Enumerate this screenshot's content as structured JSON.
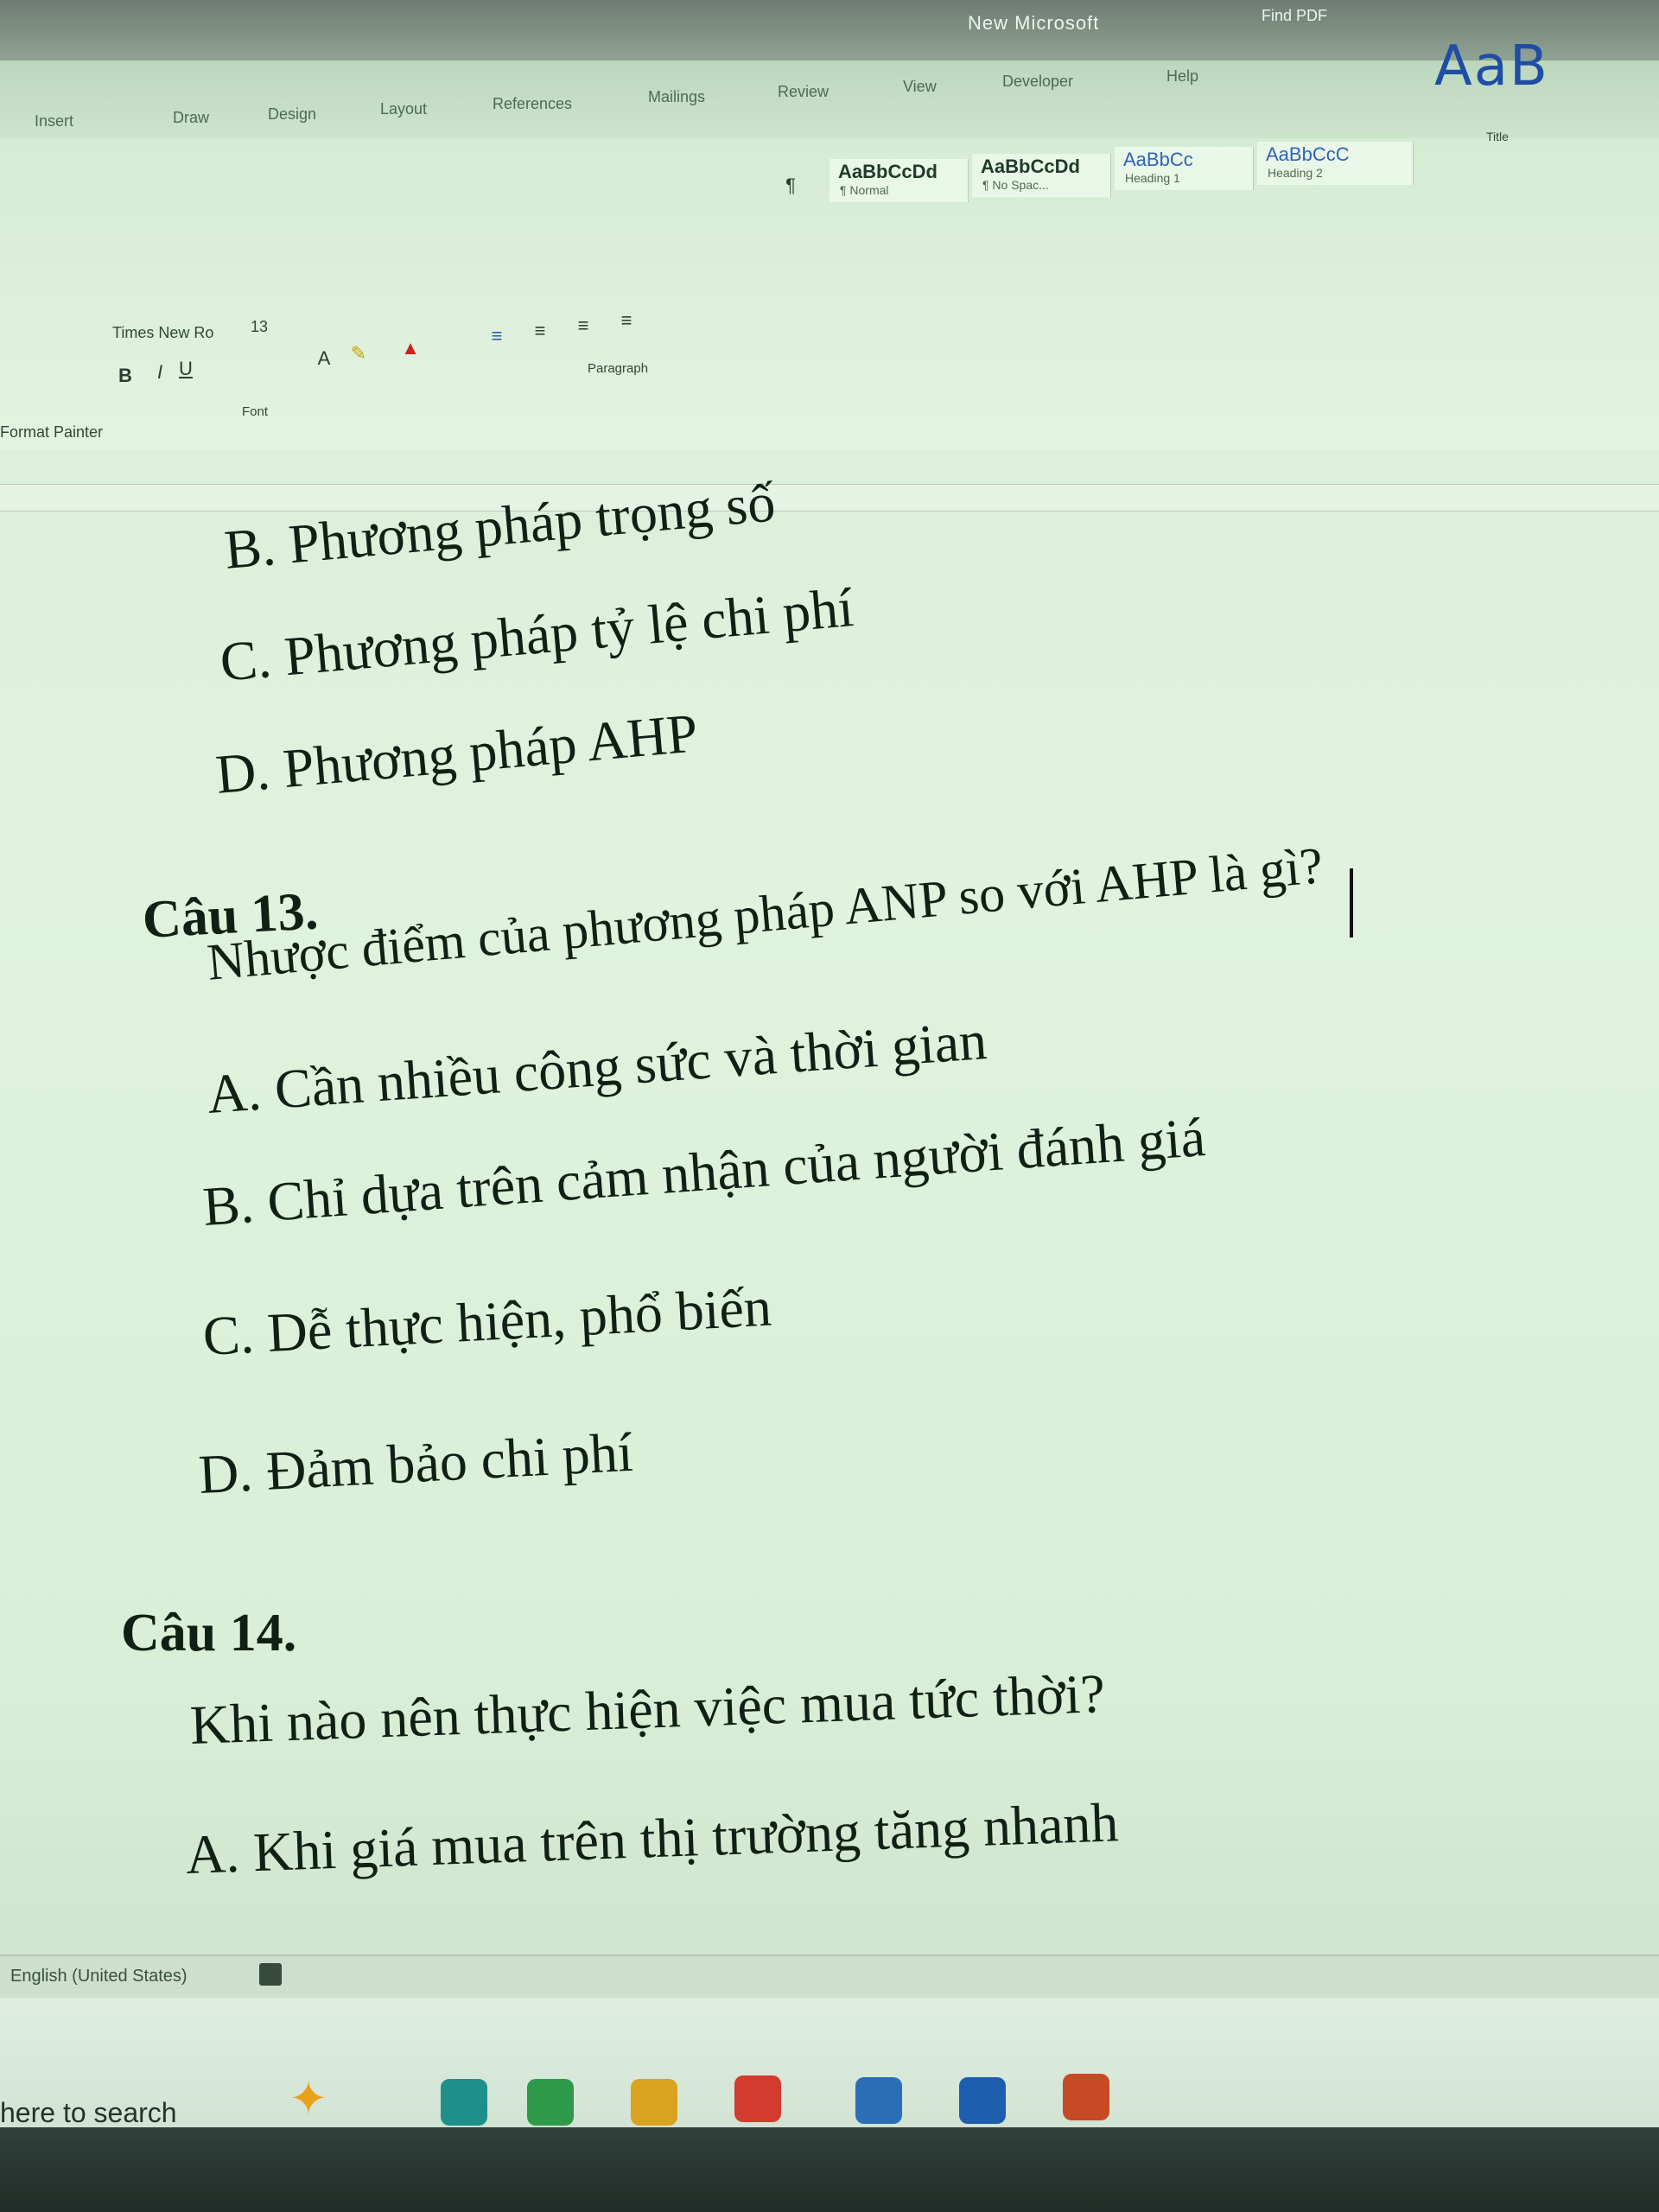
{
  "window": {
    "title": "New Microsoft",
    "right_label": "Find PDF"
  },
  "tabs": [
    {
      "label": "Insert"
    },
    {
      "label": "Draw"
    },
    {
      "label": "Design"
    },
    {
      "label": "Layout"
    },
    {
      "label": "References"
    },
    {
      "label": "Mailings"
    },
    {
      "label": "Review"
    },
    {
      "label": "View"
    },
    {
      "label": "Developer"
    },
    {
      "label": "Help"
    }
  ],
  "ribbon": {
    "font_name": "Times New Ro",
    "font_size": "13",
    "format_painter": "Format Painter",
    "font_group_label": "Font",
    "paragraph_group_label": "Paragraph",
    "styles": [
      {
        "sample": "AaBbCcDd",
        "label": "¶ Normal"
      },
      {
        "sample": "AaBbCcDd",
        "label": "¶ No Spac..."
      },
      {
        "sample": "AaBbCc",
        "label": "Heading 1"
      },
      {
        "sample": "AaBbCcC",
        "label": "Heading 2"
      }
    ],
    "title_style_sample": "AaB",
    "title_style_label": "Title"
  },
  "document": {
    "lines": [
      {
        "text": "B. Phương pháp trọng số",
        "heading": false
      },
      {
        "text": "C. Phương pháp tỷ lệ chi phí",
        "heading": false
      },
      {
        "text": "D. Phương pháp AHP",
        "heading": false
      },
      {
        "text": "Câu 13.",
        "heading": true
      },
      {
        "text": "Nhược điểm của phương pháp ANP so với AHP là gì?",
        "heading": false
      },
      {
        "text": "A. Cần nhiều công sức và thời gian",
        "heading": false
      },
      {
        "text": "B. Chỉ dựa trên cảm nhận của người đánh giá",
        "heading": false
      },
      {
        "text": "C. Dễ thực hiện, phổ biến",
        "heading": false
      },
      {
        "text": "D. Đảm bảo chi phí",
        "heading": false
      },
      {
        "text": "Câu 14.",
        "heading": true
      },
      {
        "text": "Khi nào nên thực hiện việc mua tức thời?",
        "heading": false
      },
      {
        "text": "A. Khi giá mua trên thị trường tăng nhanh",
        "heading": false
      }
    ]
  },
  "statusbar": {
    "language": "English (United States)"
  },
  "taskbar": {
    "search_placeholder": "here to search",
    "apps": [
      {
        "icon": "copilot-icon",
        "color": "#e07b2a"
      },
      {
        "icon": "edge-icon",
        "color": "#1f8f8a"
      },
      {
        "icon": "chrome-icon",
        "color": "#2f9a4a"
      },
      {
        "icon": "file-explorer-icon",
        "color": "#d9a21f"
      },
      {
        "icon": "chrome-icon",
        "color": "#d33b2e"
      },
      {
        "icon": "store-icon",
        "color": "#2a6fb5"
      },
      {
        "icon": "outlook-icon",
        "color": "#1d5fae"
      },
      {
        "icon": "powerpoint-icon",
        "color": "#c74a24"
      }
    ]
  }
}
